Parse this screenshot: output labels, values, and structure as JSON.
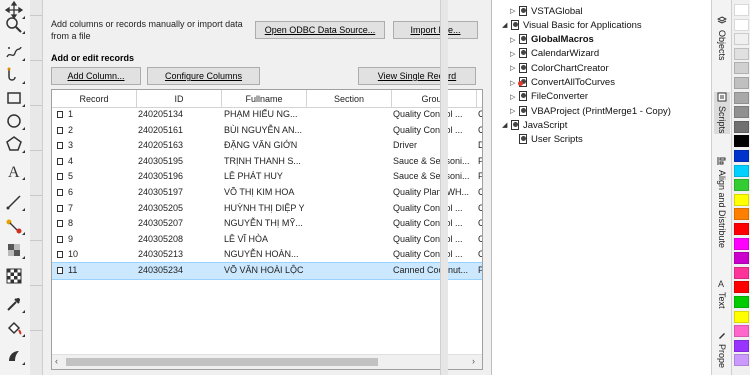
{
  "dialog": {
    "hint": "Add columns or records manually or import data from a file",
    "open_odbc_label": "Open ODBC Data Source...",
    "import_file_label": "Import File...",
    "section_title": "Add or edit records",
    "add_column_label": "Add Column...",
    "configure_columns_label": "Configure Columns",
    "view_single_record_label": "View Single Record"
  },
  "grid": {
    "columns": [
      "Record",
      "ID",
      "Fullname",
      "Section",
      "Group"
    ],
    "rows": [
      {
        "record": "1",
        "id": "240205134",
        "fullname": "PHẠM HIẾU NG...",
        "section": "",
        "group": "Quality Control ...",
        "extra": "C"
      },
      {
        "record": "2",
        "id": "240205161",
        "fullname": "BÙI NGUYỄN AN...",
        "section": "",
        "group": "Quality Control ...",
        "extra": "C"
      },
      {
        "record": "3",
        "id": "240205163",
        "fullname": "ĐẶNG VĂN GIỚN",
        "section": "",
        "group": "Driver",
        "extra": "D"
      },
      {
        "record": "4",
        "id": "240305195",
        "fullname": "TRỊNH THANH S...",
        "section": "",
        "group": "Sauce & Seasoni...",
        "extra": "P"
      },
      {
        "record": "5",
        "id": "240305196",
        "fullname": "LÊ PHÁT HUY",
        "section": "",
        "group": "Sauce & Seasoni...",
        "extra": "P"
      },
      {
        "record": "6",
        "id": "240305197",
        "fullname": "VÕ THỊ KIM HOA",
        "section": "",
        "group": "Quality Plant WH...",
        "extra": "C"
      },
      {
        "record": "7",
        "id": "240305205",
        "fullname": "HUỲNH THỊ DIỆP Y",
        "section": "",
        "group": "Quality Control ...",
        "extra": "C"
      },
      {
        "record": "8",
        "id": "240305207",
        "fullname": "NGUYỄN THỊ MỸ...",
        "section": "",
        "group": "Quality Control ...",
        "extra": "C"
      },
      {
        "record": "9",
        "id": "240305208",
        "fullname": "LÊ VĨ HÒA",
        "section": "",
        "group": "Quality Control ...",
        "extra": "C"
      },
      {
        "record": "10",
        "id": "240305213",
        "fullname": "NGUYỄN HOÀN...",
        "section": "",
        "group": "Quality Control ...",
        "extra": "C"
      },
      {
        "record": "11",
        "id": "240305234",
        "fullname": "VÕ VĂN HOÀI LỘC",
        "section": "",
        "group": "Canned Coconut...",
        "extra": "P"
      }
    ],
    "selected_row": 10
  },
  "scripts": {
    "nodes": [
      {
        "label": "VSTAGlobal",
        "level": 1,
        "bold": false,
        "expander": "▷",
        "red": false
      },
      {
        "label": "Visual Basic for Applications",
        "level": 0,
        "bold": false,
        "expander": "◢",
        "red": false
      },
      {
        "label": "GlobalMacros",
        "level": 1,
        "bold": true,
        "expander": "▷",
        "red": false
      },
      {
        "label": "CalendarWizard",
        "level": 1,
        "bold": false,
        "expander": "▷",
        "red": false
      },
      {
        "label": "ColorChartCreator",
        "level": 1,
        "bold": false,
        "expander": "▷",
        "red": false
      },
      {
        "label": "ConvertAllToCurves",
        "level": 1,
        "bold": false,
        "expander": "▷",
        "red": true
      },
      {
        "label": "FileConverter",
        "level": 1,
        "bold": false,
        "expander": "▷",
        "red": false
      },
      {
        "label": "VBAProject (PrintMerge1 - Copy)",
        "level": 1,
        "bold": false,
        "expander": "▷",
        "red": false
      },
      {
        "label": "JavaScript",
        "level": 0,
        "bold": false,
        "expander": "◢",
        "red": false
      },
      {
        "label": "User Scripts",
        "level": 1,
        "bold": false,
        "expander": "",
        "red": false
      }
    ]
  },
  "docker_tabs": [
    {
      "label": "Objects",
      "icon": "objects-icon"
    },
    {
      "label": "Scripts",
      "icon": "scripts-icon"
    },
    {
      "label": "Align and Distribute",
      "icon": "align-icon"
    },
    {
      "label": "Text",
      "icon": "text-icon"
    },
    {
      "label": "Prope",
      "icon": "properties-icon"
    }
  ],
  "palette": [
    "#ffffff",
    "#ffffff",
    "#f0f0f0",
    "#e0e0e0",
    "#d0d0d0",
    "#c0c0c0",
    "#a8a8a8",
    "#909090",
    "#707070",
    "#000000",
    "#0033cc",
    "#00d0ff",
    "#33cc33",
    "#ffff00",
    "#ff8000",
    "#ff0000",
    "#ff00ff",
    "#cc00cc",
    "#ff3399",
    "#ff0000",
    "#00cc00",
    "#ffff00",
    "#ff66cc",
    "#9933ff",
    "#cc99ff"
  ],
  "tools": [
    "pick-tool-icon",
    "zoom-tool-icon",
    "freehand-tool-icon",
    "bezier-tool-icon",
    "rectangle-tool-icon",
    "ellipse-tool-icon",
    "polygon-tool-icon",
    "text-tool-icon",
    "connector-tool-icon",
    "blend-tool-icon",
    "transparency-tool-icon",
    "checkerboard-tool-icon",
    "eyedropper-tool-icon",
    "fill-tool-icon",
    "smart-fill-tool-icon"
  ]
}
